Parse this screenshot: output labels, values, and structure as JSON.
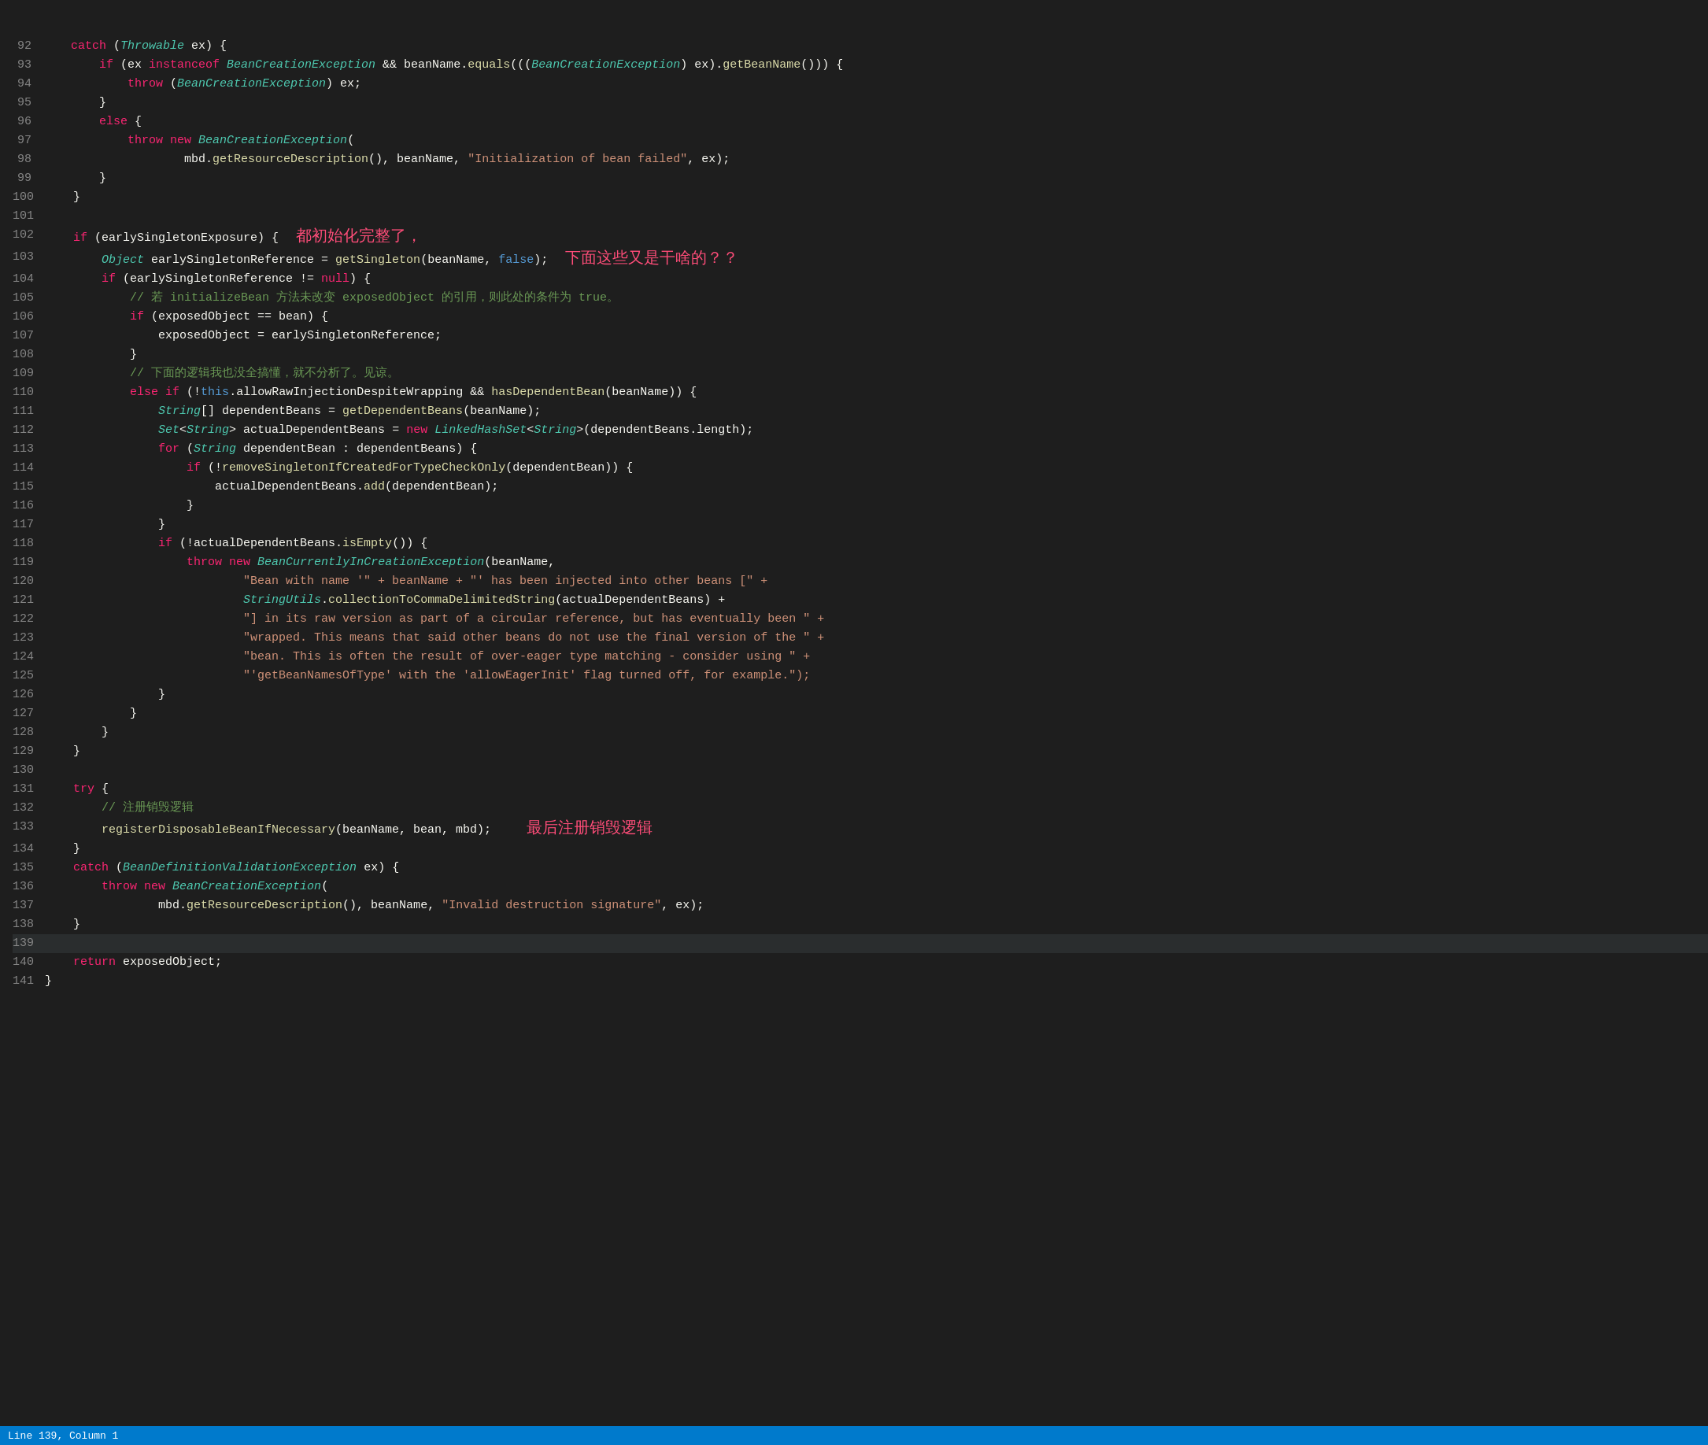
{
  "status_bar": {
    "text": "Line 139, Column 1"
  },
  "lines": [
    {
      "num": 92,
      "tokens": [
        {
          "t": "    ",
          "c": ""
        },
        {
          "t": "catch",
          "c": "kw"
        },
        {
          "t": " (",
          "c": "punct"
        },
        {
          "t": "Throwable",
          "c": "type"
        },
        {
          "t": " ex) {",
          "c": "punct"
        }
      ]
    },
    {
      "num": 93,
      "tokens": [
        {
          "t": "        ",
          "c": ""
        },
        {
          "t": "if",
          "c": "kw"
        },
        {
          "t": " (ex ",
          "c": "punct"
        },
        {
          "t": "instanceof",
          "c": "kw"
        },
        {
          "t": " ",
          "c": ""
        },
        {
          "t": "BeanCreationException",
          "c": "type"
        },
        {
          "t": " && beanName.",
          "c": "punct"
        },
        {
          "t": "equals",
          "c": "method"
        },
        {
          "t": "(((",
          "c": "punct"
        },
        {
          "t": "BeanCreationException",
          "c": "type"
        },
        {
          "t": ") ex).",
          "c": "punct"
        },
        {
          "t": "getBeanName",
          "c": "method"
        },
        {
          "t": "())) {",
          "c": "punct"
        }
      ]
    },
    {
      "num": 94,
      "tokens": [
        {
          "t": "            ",
          "c": ""
        },
        {
          "t": "throw",
          "c": "kw"
        },
        {
          "t": " (",
          "c": "punct"
        },
        {
          "t": "BeanCreationException",
          "c": "type"
        },
        {
          "t": ") ex;",
          "c": "punct"
        }
      ]
    },
    {
      "num": 95,
      "tokens": [
        {
          "t": "        }",
          "c": "punct"
        }
      ]
    },
    {
      "num": 96,
      "tokens": [
        {
          "t": "        ",
          "c": ""
        },
        {
          "t": "else",
          "c": "kw"
        },
        {
          "t": " {",
          "c": "punct"
        }
      ]
    },
    {
      "num": 97,
      "tokens": [
        {
          "t": "            ",
          "c": ""
        },
        {
          "t": "throw",
          "c": "kw"
        },
        {
          "t": " ",
          "c": ""
        },
        {
          "t": "new",
          "c": "kw"
        },
        {
          "t": " ",
          "c": ""
        },
        {
          "t": "BeanCreationException",
          "c": "type"
        },
        {
          "t": "(",
          "c": "punct"
        }
      ]
    },
    {
      "num": 98,
      "tokens": [
        {
          "t": "                    ",
          "c": ""
        },
        {
          "t": "mbd.",
          "c": "punct"
        },
        {
          "t": "getResourceDescription",
          "c": "method"
        },
        {
          "t": "(), beanName, ",
          "c": "punct"
        },
        {
          "t": "\"Initialization of bean failed\"",
          "c": "str"
        },
        {
          "t": ", ex);",
          "c": "punct"
        }
      ]
    },
    {
      "num": 99,
      "tokens": [
        {
          "t": "        }",
          "c": "punct"
        }
      ]
    },
    {
      "num": 100,
      "tokens": [
        {
          "t": "    }",
          "c": "punct"
        }
      ]
    },
    {
      "num": 101,
      "tokens": []
    },
    {
      "num": 102,
      "tokens": [
        {
          "t": "    ",
          "c": ""
        },
        {
          "t": "if",
          "c": "kw"
        },
        {
          "t": " (earlySingletonExposure) {",
          "c": "punct"
        },
        {
          "t": "    都初始化完整了，",
          "c": "chinese-note"
        },
        {
          "t": "",
          "c": ""
        }
      ]
    },
    {
      "num": 103,
      "tokens": [
        {
          "t": "        ",
          "c": ""
        },
        {
          "t": "Object",
          "c": "type"
        },
        {
          "t": " earlySingletonReference = ",
          "c": "punct"
        },
        {
          "t": "getSingleton",
          "c": "method"
        },
        {
          "t": "(beanName, ",
          "c": "punct"
        },
        {
          "t": "false",
          "c": "bool"
        },
        {
          "t": ");",
          "c": "punct"
        },
        {
          "t": "    下面这些又是干啥的？？",
          "c": "chinese-note"
        }
      ]
    },
    {
      "num": 104,
      "tokens": [
        {
          "t": "        ",
          "c": ""
        },
        {
          "t": "if",
          "c": "kw"
        },
        {
          "t": " (earlySingletonReference != ",
          "c": "punct"
        },
        {
          "t": "null",
          "c": "kw"
        },
        {
          "t": ") {",
          "c": "punct"
        }
      ]
    },
    {
      "num": 105,
      "tokens": [
        {
          "t": "            ",
          "c": ""
        },
        {
          "t": "// 若 initializeBean 方法未改变 exposedObject 的引用，则此处的条件为 true。",
          "c": "comment-zh"
        }
      ]
    },
    {
      "num": 106,
      "tokens": [
        {
          "t": "            ",
          "c": ""
        },
        {
          "t": "if",
          "c": "kw"
        },
        {
          "t": " (exposedObject == bean) {",
          "c": "punct"
        }
      ]
    },
    {
      "num": 107,
      "tokens": [
        {
          "t": "                ",
          "c": ""
        },
        {
          "t": "exposedObject = earlySingletonReference;",
          "c": "punct"
        }
      ]
    },
    {
      "num": 108,
      "tokens": [
        {
          "t": "            }",
          "c": "punct"
        }
      ]
    },
    {
      "num": 109,
      "tokens": [
        {
          "t": "            ",
          "c": ""
        },
        {
          "t": "// 下面的逻辑我也没全搞懂，就不分析了。见谅。",
          "c": "comment-zh"
        }
      ]
    },
    {
      "num": 110,
      "tokens": [
        {
          "t": "            ",
          "c": ""
        },
        {
          "t": "else",
          "c": "kw"
        },
        {
          "t": " ",
          "c": ""
        },
        {
          "t": "if",
          "c": "kw"
        },
        {
          "t": " (!",
          "c": "punct"
        },
        {
          "t": "this",
          "c": "this"
        },
        {
          "t": ".allowRawInjectionDespiteWrapping && ",
          "c": "punct"
        },
        {
          "t": "hasDependentBean",
          "c": "method"
        },
        {
          "t": "(beanName)) {",
          "c": "punct"
        }
      ]
    },
    {
      "num": 111,
      "tokens": [
        {
          "t": "                ",
          "c": ""
        },
        {
          "t": "String",
          "c": "type"
        },
        {
          "t": "[] dependentBeans = ",
          "c": "punct"
        },
        {
          "t": "getDependentBeans",
          "c": "method"
        },
        {
          "t": "(beanName);",
          "c": "punct"
        }
      ]
    },
    {
      "num": 112,
      "tokens": [
        {
          "t": "                ",
          "c": ""
        },
        {
          "t": "Set",
          "c": "type"
        },
        {
          "t": "<",
          "c": "punct"
        },
        {
          "t": "String",
          "c": "type"
        },
        {
          "t": "> actualDependentBeans = ",
          "c": "punct"
        },
        {
          "t": "new",
          "c": "kw"
        },
        {
          "t": " ",
          "c": ""
        },
        {
          "t": "LinkedHashSet",
          "c": "type"
        },
        {
          "t": "<",
          "c": "punct"
        },
        {
          "t": "String",
          "c": "type"
        },
        {
          "t": ">(dependentBeans.length);",
          "c": "punct"
        }
      ]
    },
    {
      "num": 113,
      "tokens": [
        {
          "t": "                ",
          "c": ""
        },
        {
          "t": "for",
          "c": "kw"
        },
        {
          "t": " (",
          "c": "punct"
        },
        {
          "t": "String",
          "c": "type"
        },
        {
          "t": " dependentBean : dependentBeans) {",
          "c": "punct"
        }
      ]
    },
    {
      "num": 114,
      "tokens": [
        {
          "t": "                    ",
          "c": ""
        },
        {
          "t": "if",
          "c": "kw"
        },
        {
          "t": " (!",
          "c": "punct"
        },
        {
          "t": "removeSingletonIfCreatedForTypeCheckOnly",
          "c": "method"
        },
        {
          "t": "(dependentBean)) {",
          "c": "punct"
        }
      ]
    },
    {
      "num": 115,
      "tokens": [
        {
          "t": "                        ",
          "c": ""
        },
        {
          "t": "actualDependentBeans.",
          "c": "punct"
        },
        {
          "t": "add",
          "c": "method"
        },
        {
          "t": "(dependentBean);",
          "c": "punct"
        }
      ]
    },
    {
      "num": 116,
      "tokens": [
        {
          "t": "                    }",
          "c": "punct"
        }
      ]
    },
    {
      "num": 117,
      "tokens": [
        {
          "t": "                }",
          "c": "punct"
        }
      ]
    },
    {
      "num": 118,
      "tokens": [
        {
          "t": "                ",
          "c": ""
        },
        {
          "t": "if",
          "c": "kw"
        },
        {
          "t": " (!actualDependentBeans.",
          "c": "punct"
        },
        {
          "t": "isEmpty",
          "c": "method"
        },
        {
          "t": "()) {",
          "c": "punct"
        }
      ]
    },
    {
      "num": 119,
      "tokens": [
        {
          "t": "                    ",
          "c": ""
        },
        {
          "t": "throw",
          "c": "kw"
        },
        {
          "t": " ",
          "c": ""
        },
        {
          "t": "new",
          "c": "kw"
        },
        {
          "t": " ",
          "c": ""
        },
        {
          "t": "BeanCurrentlyInCreationException",
          "c": "type"
        },
        {
          "t": "(beanName,",
          "c": "punct"
        }
      ]
    },
    {
      "num": 120,
      "tokens": [
        {
          "t": "                            ",
          "c": ""
        },
        {
          "t": "\"Bean with name '\" + beanName + \"' has been injected into other beans [\" +",
          "c": "str"
        }
      ]
    },
    {
      "num": 121,
      "tokens": [
        {
          "t": "                            ",
          "c": ""
        },
        {
          "t": "StringUtils",
          "c": "type"
        },
        {
          "t": ".",
          "c": "punct"
        },
        {
          "t": "collectionToCommaDelimitedString",
          "c": "method"
        },
        {
          "t": "(actualDependentBeans) +",
          "c": "punct"
        }
      ]
    },
    {
      "num": 122,
      "tokens": [
        {
          "t": "                            ",
          "c": ""
        },
        {
          "t": "\"] in its raw version as part of a circular reference, but has eventually been \" +",
          "c": "str"
        }
      ]
    },
    {
      "num": 123,
      "tokens": [
        {
          "t": "                            ",
          "c": ""
        },
        {
          "t": "\"wrapped. This means that said other beans do not use the final version of the \" +",
          "c": "str"
        }
      ]
    },
    {
      "num": 124,
      "tokens": [
        {
          "t": "                            ",
          "c": ""
        },
        {
          "t": "\"bean. This is often the result of over-eager type matching - consider using \" +",
          "c": "str"
        }
      ]
    },
    {
      "num": 125,
      "tokens": [
        {
          "t": "                            ",
          "c": ""
        },
        {
          "t": "\"'getBeanNamesOfType' with the 'allowEagerInit' flag turned off, for example.\");",
          "c": "str"
        }
      ]
    },
    {
      "num": 126,
      "tokens": [
        {
          "t": "                }",
          "c": "punct"
        }
      ]
    },
    {
      "num": 127,
      "tokens": [
        {
          "t": "            }",
          "c": "punct"
        }
      ]
    },
    {
      "num": 128,
      "tokens": [
        {
          "t": "        }",
          "c": "punct"
        }
      ]
    },
    {
      "num": 129,
      "tokens": [
        {
          "t": "    }",
          "c": "punct"
        }
      ]
    },
    {
      "num": 130,
      "tokens": []
    },
    {
      "num": 131,
      "tokens": [
        {
          "t": "    ",
          "c": ""
        },
        {
          "t": "try",
          "c": "kw"
        },
        {
          "t": " {",
          "c": "punct"
        }
      ]
    },
    {
      "num": 132,
      "tokens": [
        {
          "t": "        ",
          "c": ""
        },
        {
          "t": "// 注册销毁逻辑",
          "c": "comment-zh"
        }
      ]
    },
    {
      "num": 133,
      "tokens": [
        {
          "t": "        ",
          "c": ""
        },
        {
          "t": "registerDisposableBeanIfNecessary",
          "c": "method"
        },
        {
          "t": "(beanName, bean, mbd);",
          "c": "punct"
        },
        {
          "t": "        最后注册销毁逻辑",
          "c": "chinese-note"
        }
      ]
    },
    {
      "num": 134,
      "tokens": [
        {
          "t": "    }",
          "c": "punct"
        }
      ]
    },
    {
      "num": 135,
      "tokens": [
        {
          "t": "    ",
          "c": ""
        },
        {
          "t": "catch",
          "c": "kw"
        },
        {
          "t": " (",
          "c": "punct"
        },
        {
          "t": "BeanDefinitionValidationException",
          "c": "type"
        },
        {
          "t": " ex) {",
          "c": "punct"
        }
      ]
    },
    {
      "num": 136,
      "tokens": [
        {
          "t": "        ",
          "c": ""
        },
        {
          "t": "throw",
          "c": "kw"
        },
        {
          "t": " ",
          "c": ""
        },
        {
          "t": "new",
          "c": "kw"
        },
        {
          "t": " ",
          "c": ""
        },
        {
          "t": "BeanCreationException",
          "c": "type"
        },
        {
          "t": "(",
          "c": "punct"
        }
      ]
    },
    {
      "num": 137,
      "tokens": [
        {
          "t": "                ",
          "c": ""
        },
        {
          "t": "mbd.",
          "c": "punct"
        },
        {
          "t": "getResourceDescription",
          "c": "method"
        },
        {
          "t": "(), beanName, ",
          "c": "punct"
        },
        {
          "t": "\"Invalid destruction signature\"",
          "c": "str"
        },
        {
          "t": ", ex);",
          "c": "punct"
        }
      ]
    },
    {
      "num": 138,
      "tokens": [
        {
          "t": "    }",
          "c": "punct"
        }
      ]
    },
    {
      "num": 139,
      "tokens": []
    },
    {
      "num": 140,
      "tokens": [
        {
          "t": "    ",
          "c": ""
        },
        {
          "t": "return",
          "c": "kw"
        },
        {
          "t": " exposedObject;",
          "c": "punct"
        }
      ]
    },
    {
      "num": 141,
      "tokens": [
        {
          "t": "}",
          "c": "punct"
        },
        {
          "t": " ",
          "c": ""
        }
      ]
    }
  ]
}
